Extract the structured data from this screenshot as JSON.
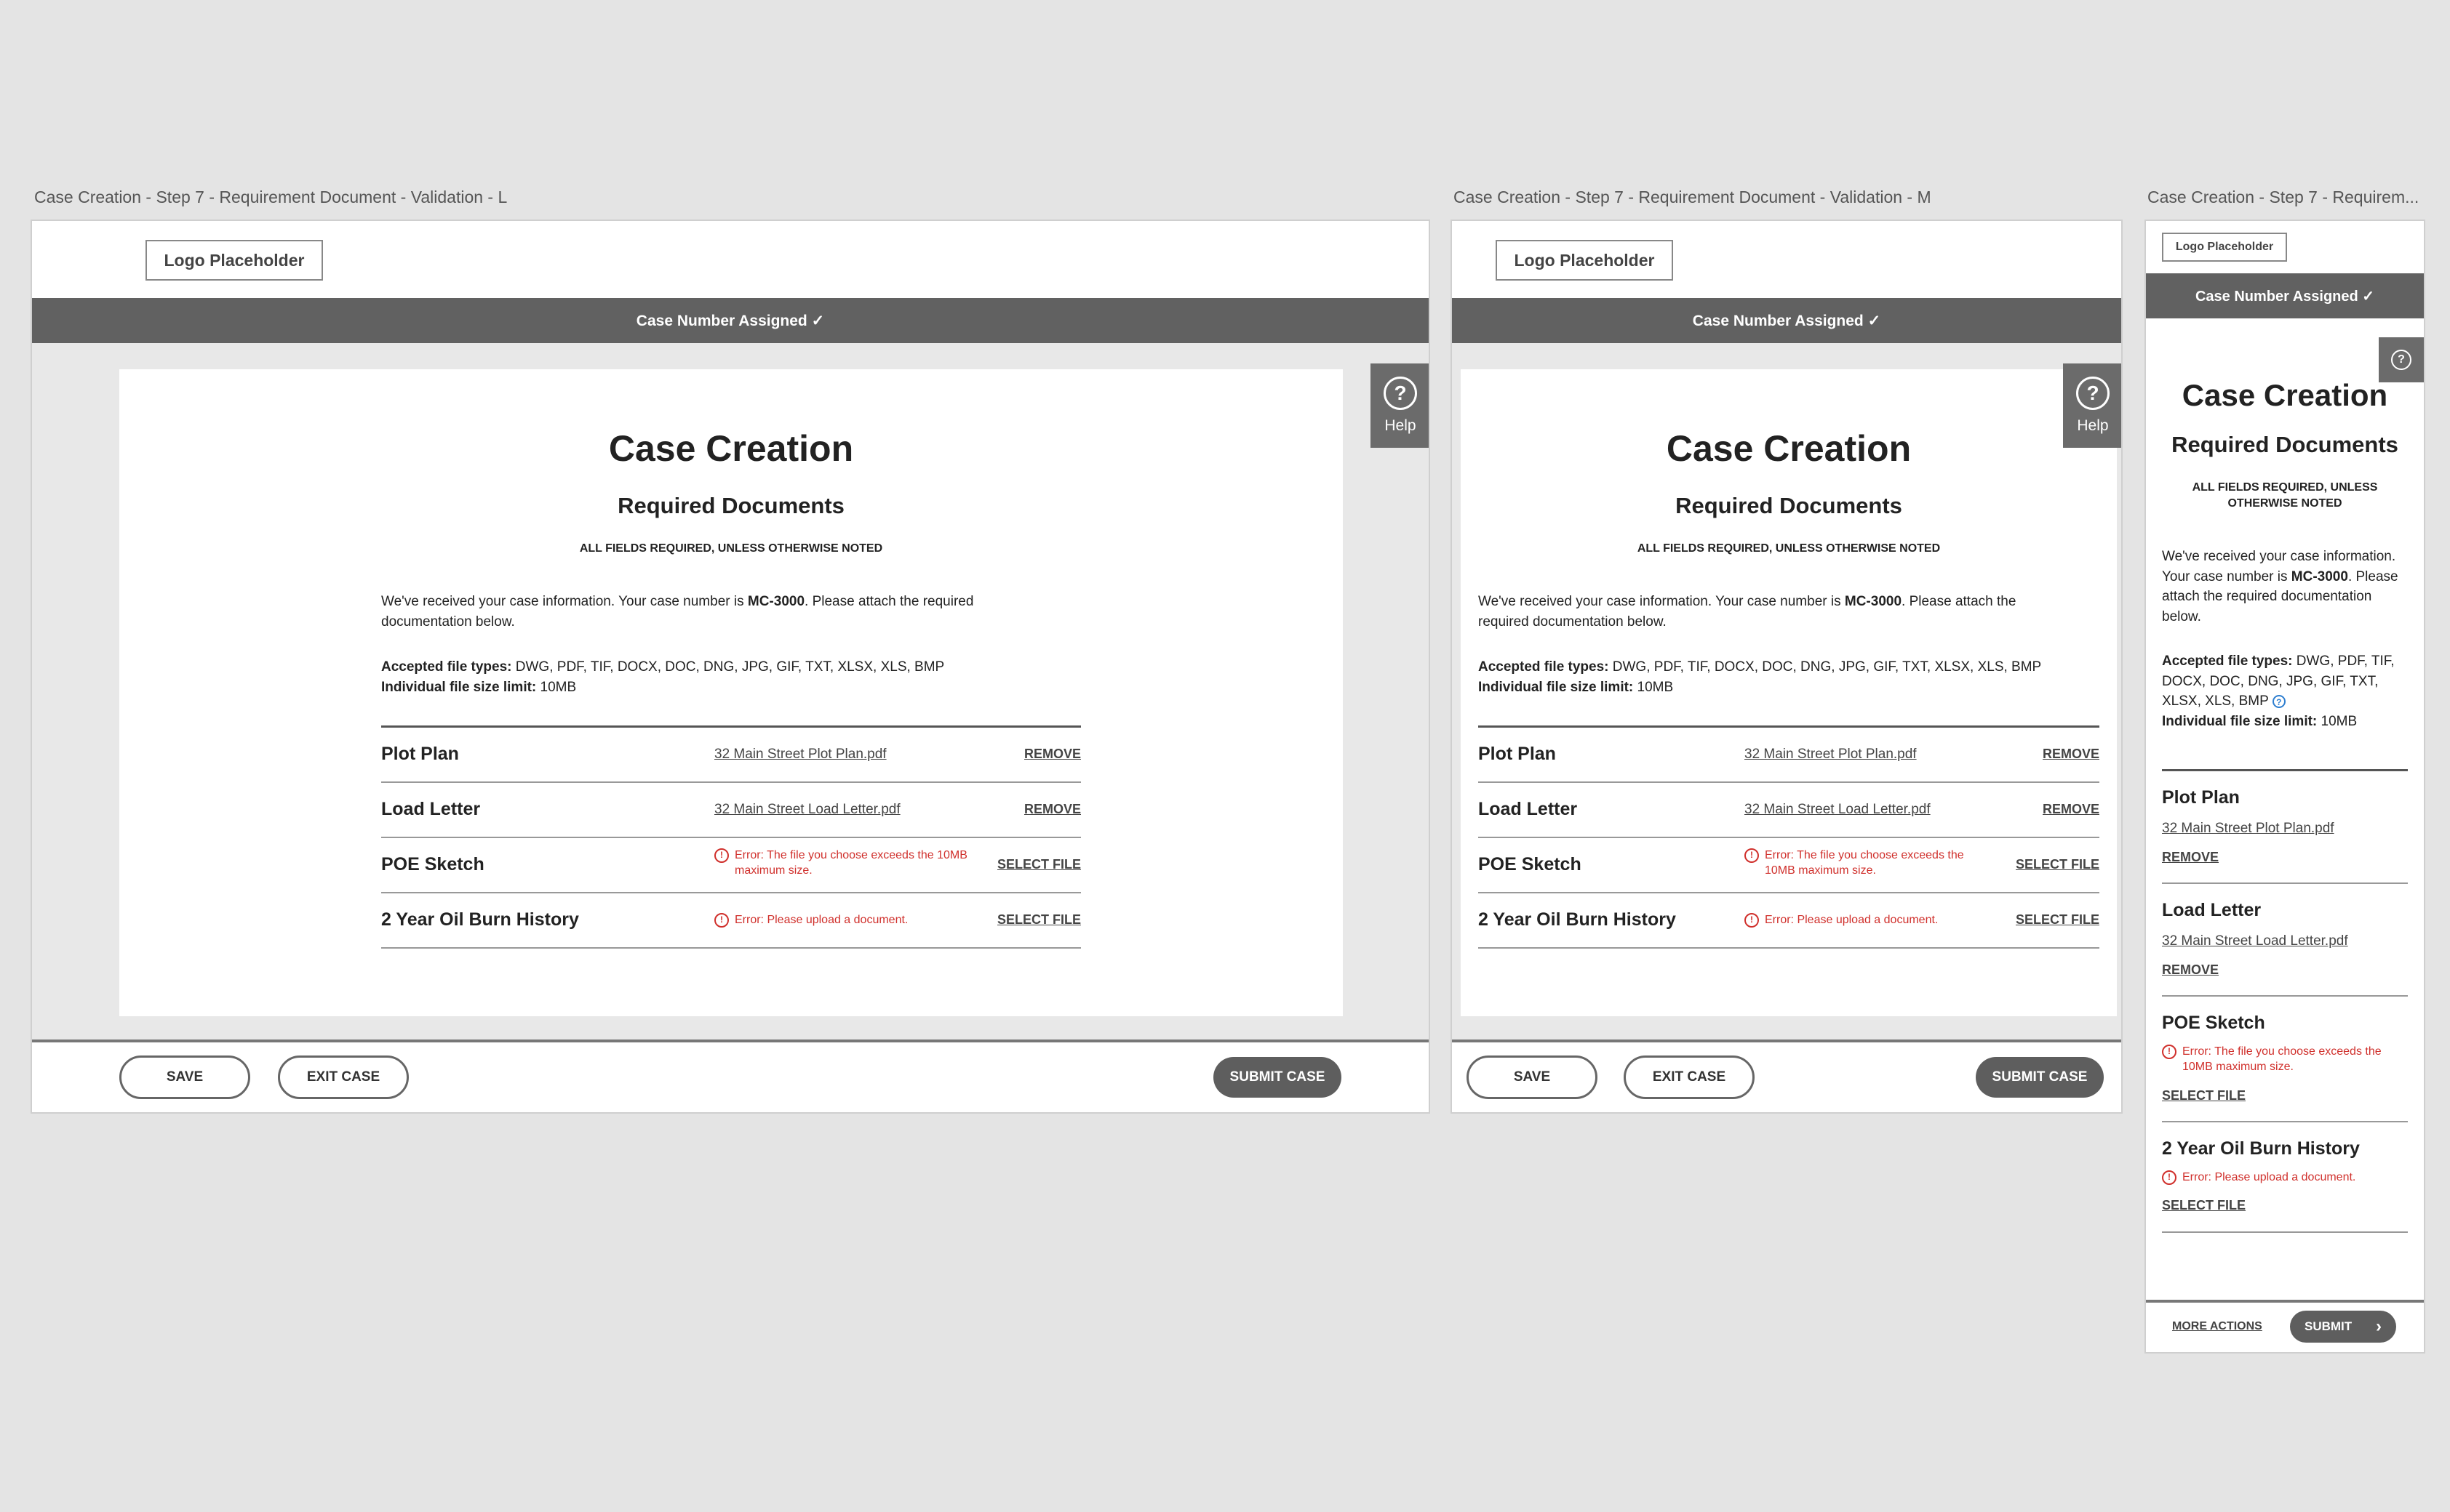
{
  "frames": [
    {
      "label": "Case Creation - Step 7 - Requirement Document - Validation - L"
    },
    {
      "label": "Case Creation - Step 7 - Requirement Document - Validation - M"
    },
    {
      "label": "Case Creation - Step 7 - Requirem..."
    }
  ],
  "logo": "Logo Placeholder",
  "banner": "Case Number Assigned ✓",
  "help_label": "Help",
  "help_icon": "?",
  "title": "Case Creation",
  "subtitle": "Required Documents",
  "required_note": "ALL FIELDS REQUIRED, UNLESS OTHERWISE NOTED",
  "intro": {
    "before": "We've received your case information. Your case number is ",
    "case_number": "MC-3000",
    "after": ". Please attach the required documentation below."
  },
  "accepted": {
    "label": "Accepted file types:",
    "value": " DWG, PDF, TIF, DOCX, DOC, DNG, JPG, GIF, TXT, XLSX, XLS, BMP"
  },
  "size_limit": {
    "label": "Individual file size limit:",
    "value": " 10MB"
  },
  "documents": [
    {
      "name": "Plot Plan",
      "file": "32 Main Street Plot Plan.pdf",
      "action": "REMOVE"
    },
    {
      "name": "Load Letter",
      "file": "32 Main Street Load Letter.pdf",
      "action": "REMOVE"
    },
    {
      "name": "POE Sketch",
      "error": "Error: The file you choose exceeds the 10MB maximum size.",
      "action": "SELECT FILE"
    },
    {
      "name": "2 Year Oil Burn History",
      "error": "Error: Please upload a document.",
      "action": "SELECT FILE"
    }
  ],
  "error_icon": "!",
  "buttons": {
    "save": "SAVE",
    "exit": "EXIT CASE",
    "submit_case": "SUBMIT CASE",
    "more_actions": "MORE ACTIONS",
    "submit": "SUBMIT",
    "submit_chevron": "›"
  },
  "colors": {
    "banner": "#616161",
    "error": "#d0302c",
    "info": "#2f7fd0"
  }
}
